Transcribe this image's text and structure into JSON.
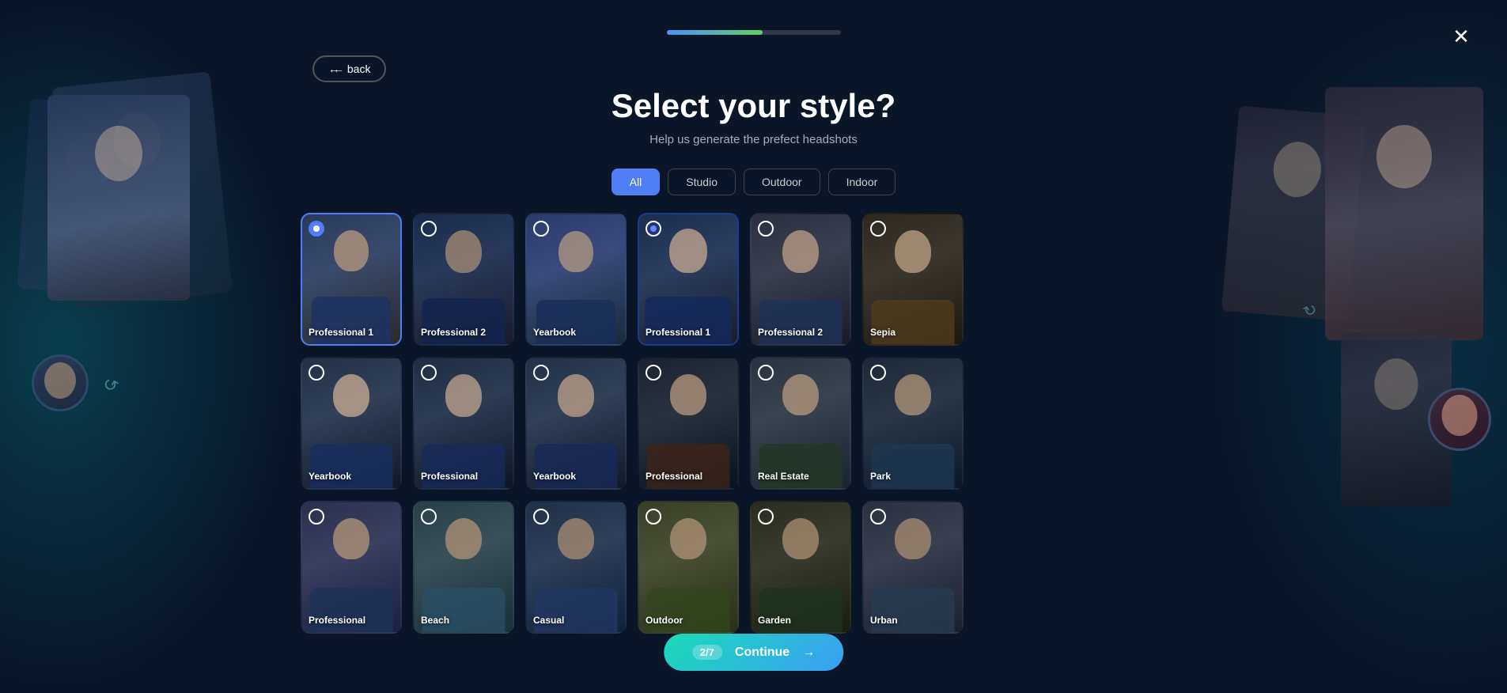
{
  "app": {
    "title": "Select your style?",
    "subtitle": "Help us generate the prefect headshots"
  },
  "progress": {
    "fill_percent": 55,
    "step_current": "2",
    "step_total": "7"
  },
  "close_button_label": "✕",
  "back_button_label": "← back",
  "continue_button_label": "Continue",
  "continue_arrow": "→",
  "filters": [
    {
      "id": "all",
      "label": "All",
      "active": true
    },
    {
      "id": "studio",
      "label": "Studio",
      "active": false
    },
    {
      "id": "outdoor",
      "label": "Outdoor",
      "active": false
    },
    {
      "id": "indoor",
      "label": "Indoor",
      "active": false
    }
  ],
  "styles": [
    {
      "id": "s1",
      "label": "Professional 1",
      "portrait_class": "portrait-1",
      "selected": "blue"
    },
    {
      "id": "s2",
      "label": "Professional 2",
      "portrait_class": "portrait-2",
      "selected": "none"
    },
    {
      "id": "s3",
      "label": "Yearbook",
      "portrait_class": "portrait-3",
      "selected": "none"
    },
    {
      "id": "s4",
      "label": "Professional 1",
      "portrait_class": "portrait-4",
      "selected": "dark-blue"
    },
    {
      "id": "s5",
      "label": "Professional 2",
      "portrait_class": "portrait-5",
      "selected": "none"
    },
    {
      "id": "s6",
      "label": "Sepia",
      "portrait_class": "portrait-6",
      "selected": "none"
    },
    {
      "id": "s7",
      "label": "Yearbook",
      "portrait_class": "portrait-7",
      "selected": "none"
    },
    {
      "id": "s8",
      "label": "Professional",
      "portrait_class": "portrait-8",
      "selected": "none"
    },
    {
      "id": "s9",
      "label": "Yearbook",
      "portrait_class": "portrait-9",
      "selected": "none"
    },
    {
      "id": "s10",
      "label": "Professional",
      "portrait_class": "portrait-10",
      "selected": "none"
    },
    {
      "id": "s11",
      "label": "Real Estate",
      "portrait_class": "portrait-11",
      "selected": "none"
    },
    {
      "id": "s12",
      "label": "Park",
      "portrait_class": "portrait-12",
      "selected": "none"
    },
    {
      "id": "s13",
      "label": "Professional",
      "portrait_class": "portrait-13",
      "selected": "none"
    },
    {
      "id": "s14",
      "label": "Beach",
      "portrait_class": "portrait-14",
      "selected": "none"
    },
    {
      "id": "s15",
      "label": "Casual",
      "portrait_class": "portrait-15",
      "selected": "none"
    },
    {
      "id": "s16",
      "label": "Outdoor",
      "portrait_class": "portrait-16",
      "selected": "none"
    },
    {
      "id": "s17",
      "label": "Garden",
      "portrait_class": "portrait-17",
      "selected": "none"
    },
    {
      "id": "s18",
      "label": "Urban",
      "portrait_class": "portrait-18",
      "selected": "none"
    }
  ]
}
